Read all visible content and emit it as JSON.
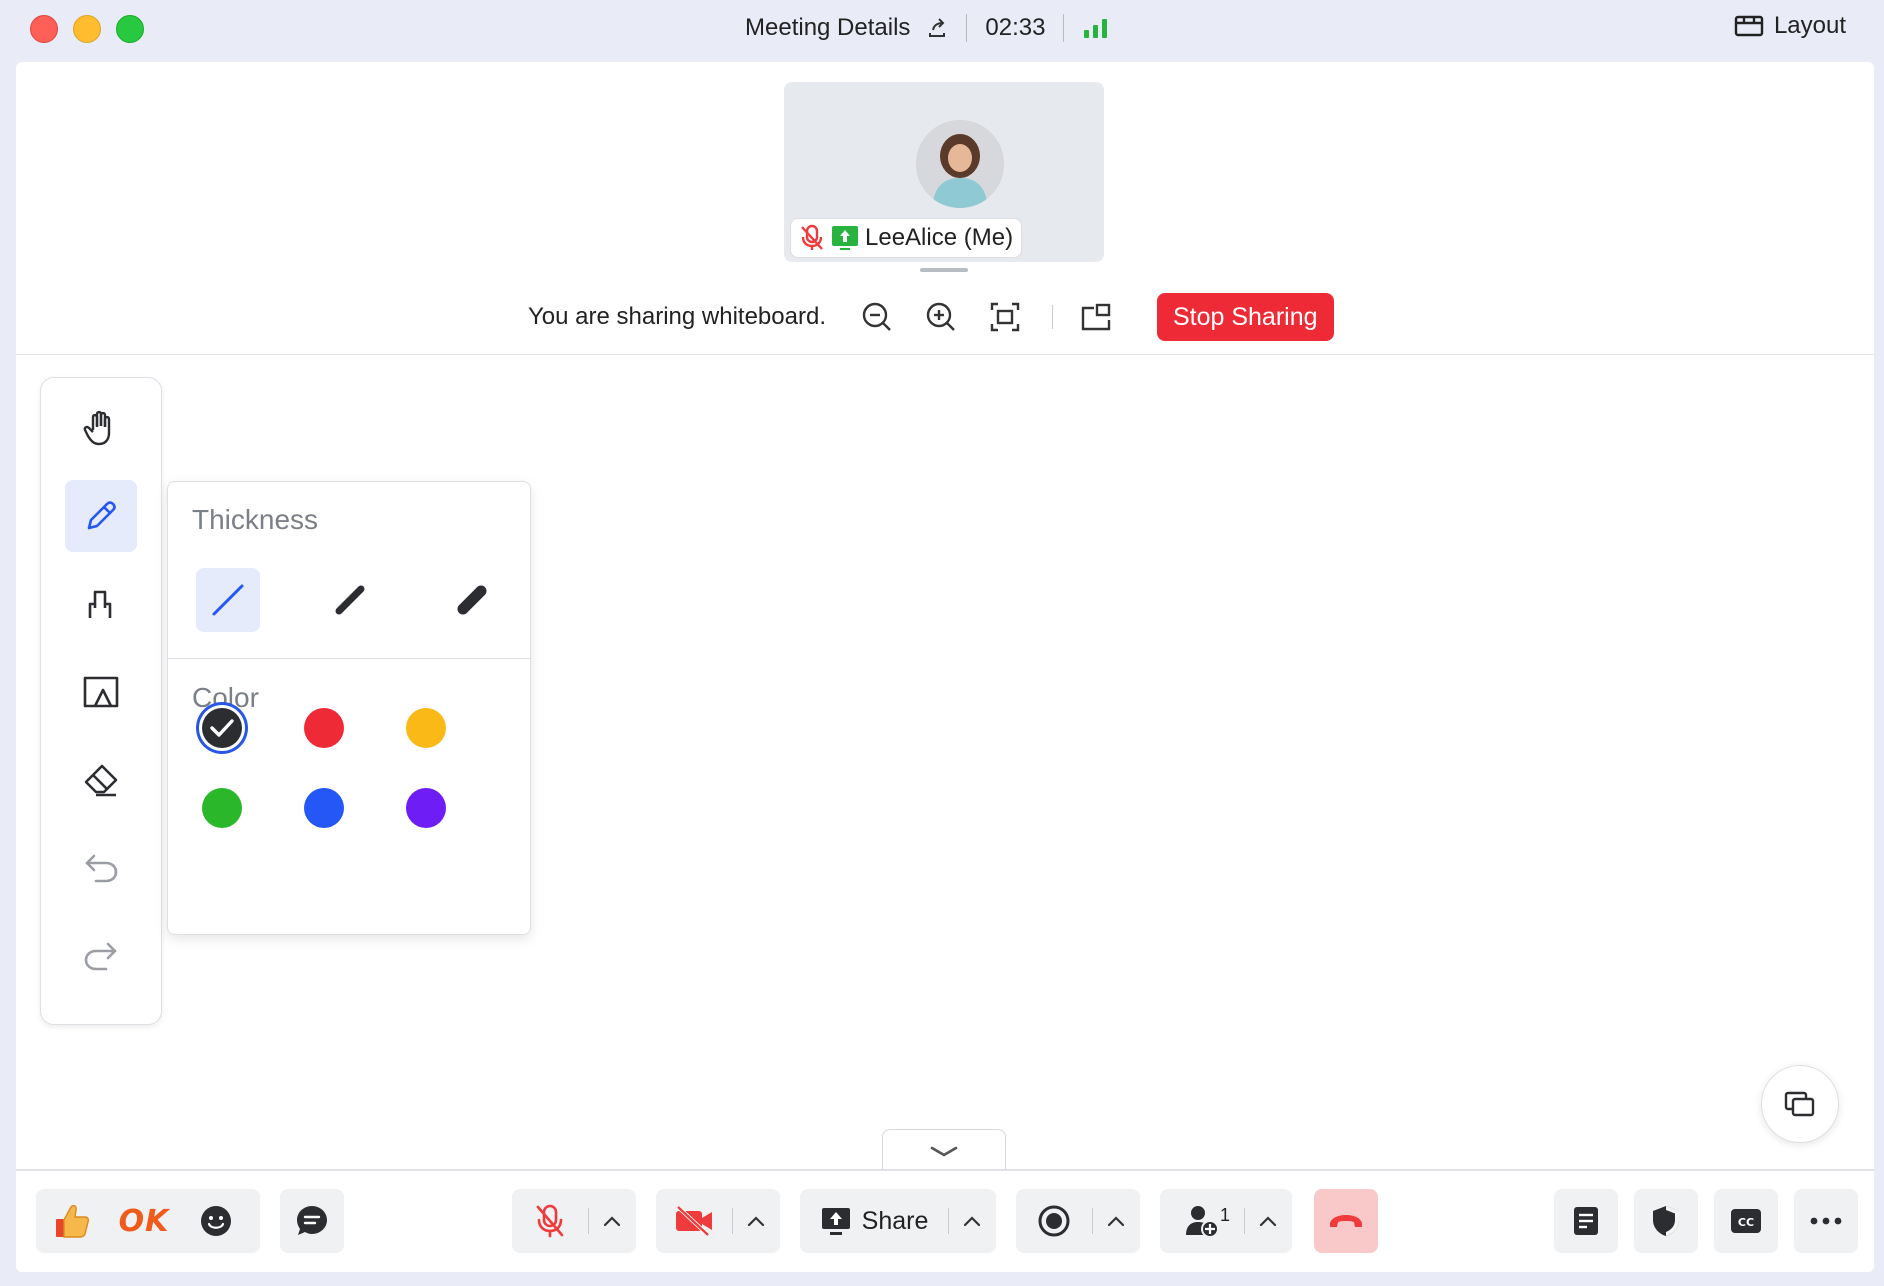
{
  "titlebar": {
    "title": "Meeting Details",
    "timer": "02:33",
    "layout_label": "Layout",
    "signal_color": "#28b33f"
  },
  "video": {
    "participant_name": "LeeAlice (Me)",
    "muted": true,
    "sharing": true
  },
  "share_bar": {
    "status_text": "You are sharing whiteboard.",
    "stop_label": "Stop Sharing",
    "stop_color": "#ee2a36"
  },
  "whiteboard": {
    "tools": [
      {
        "name": "hand-tool",
        "icon": "hand-icon"
      },
      {
        "name": "pen-tool",
        "icon": "pencil-icon",
        "active": true
      },
      {
        "name": "shape-tool",
        "icon": "shape-icon"
      },
      {
        "name": "image-tool",
        "icon": "image-icon"
      },
      {
        "name": "eraser-tool",
        "icon": "eraser-icon"
      },
      {
        "name": "undo-tool",
        "icon": "undo-icon"
      },
      {
        "name": "redo-tool",
        "icon": "redo-icon"
      }
    ],
    "popover": {
      "thickness_label": "Thickness",
      "color_label": "Color",
      "thickness_selected": 0,
      "colors": [
        "#2b2d31",
        "#ee2a36",
        "#fbb917",
        "#2ab72a",
        "#2457f5",
        "#6e1ef5"
      ],
      "selected_color": 0
    }
  },
  "toolbar": {
    "ok_label": "OK",
    "share_label": "Share",
    "participant_count": "1",
    "accent": "#ef3b3b"
  }
}
